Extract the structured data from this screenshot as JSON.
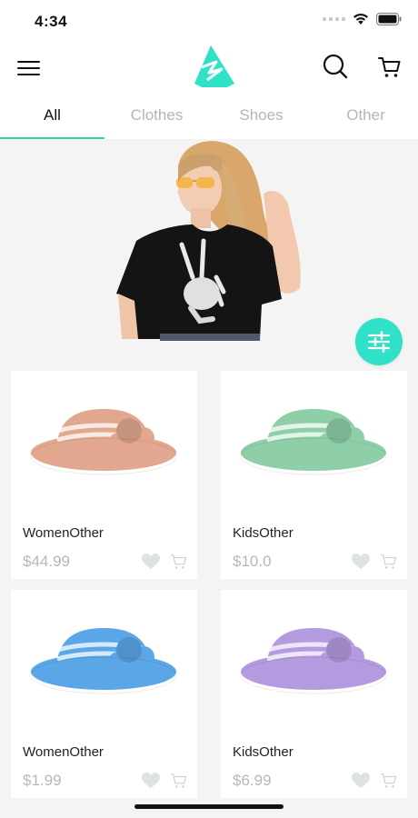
{
  "status": {
    "time": "4:34"
  },
  "header": {
    "menu_icon": "hamburger-menu-icon",
    "logo_icon": "brand-logo",
    "search_icon": "search-icon",
    "cart_icon": "cart-icon"
  },
  "tabs": [
    {
      "label": "All",
      "active": true
    },
    {
      "label": "Clothes",
      "active": false
    },
    {
      "label": "Shoes",
      "active": false
    },
    {
      "label": "Other",
      "active": false
    }
  ],
  "hero": {
    "image": "model-black-tshirt-skeleton-hand"
  },
  "filter_icon": "sliders-filter-icon",
  "accent_color": "#2ed1a8",
  "products": [
    {
      "name": "WomenOther",
      "price": "$44.99",
      "hat_color": "#e2a88f"
    },
    {
      "name": "KidsOther",
      "price": "$10.0",
      "hat_color": "#8ecfa8"
    },
    {
      "name": "WomenOther",
      "price": "$1.99",
      "hat_color": "#5ba6e6"
    },
    {
      "name": "KidsOther",
      "price": "$6.99",
      "hat_color": "#b49be0"
    }
  ]
}
